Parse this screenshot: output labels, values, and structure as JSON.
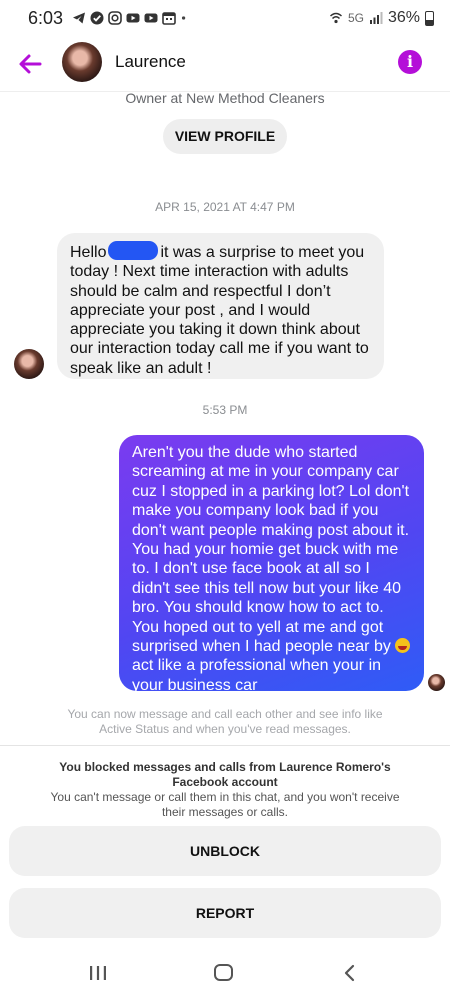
{
  "status_bar": {
    "time": "6:03",
    "network": "5G",
    "battery": "36%",
    "notification_icons": [
      "telegram-icon",
      "verified-icon",
      "instagram-icon",
      "youtube-icon",
      "youtube-icon",
      "calendar-icon",
      "dot-icon"
    ]
  },
  "header": {
    "name": "Laurence",
    "back_icon": "back-arrow-icon",
    "info_icon": "info-icon",
    "info_glyph": "i"
  },
  "profile": {
    "subtitle": "Owner at New Method Cleaners",
    "view_profile_label": "VIEW PROFILE"
  },
  "messages": [
    {
      "timestamp": "APR 15, 2021 AT 4:47 PM",
      "direction": "received",
      "text_before_redaction": "Hello",
      "text_after_redaction": "it was a surprise to meet you today ! Next time interaction with adults should be calm and respectful I don’t appreciate your post , and I would appreciate you taking it down think about our interaction today call me if you want to speak like an adult !"
    },
    {
      "timestamp": "5:53 PM",
      "direction": "sent",
      "text_before_emoji": "Aren't you the dude who started screaming at me in your company car cuz I stopped in a parking lot? Lol don't make you company look bad if you don't want people making post about it. You had your homie get buck with me to.   I don't use face book at all so I didn't see this tell now but your like 40 bro.  You should know how to act to. You hoped out to yell at me and got surprised when I had people near by",
      "emoji": "laughing-emoji",
      "text_after_emoji": "act like a professional when your in your business car"
    }
  ],
  "info_note": "You can now message and call each other and see info like Active Status and when you've read messages.",
  "blocked": {
    "title": "You blocked messages and calls from Laurence Romero's Facebook account",
    "subtitle": "You can't message or call them in this chat, and you won't receive their messages or calls.",
    "unblock_label": "UNBLOCK",
    "report_label": "REPORT"
  },
  "nav": {
    "icons": [
      "recent-apps-icon",
      "home-icon",
      "back-icon"
    ]
  },
  "colors": {
    "accent": "#b40fd8",
    "sent_gradient_start": "#7b3bf0",
    "sent_gradient_end": "#2f5cf6",
    "received_bubble": "#f0f0f0",
    "redaction": "#2356f3"
  }
}
